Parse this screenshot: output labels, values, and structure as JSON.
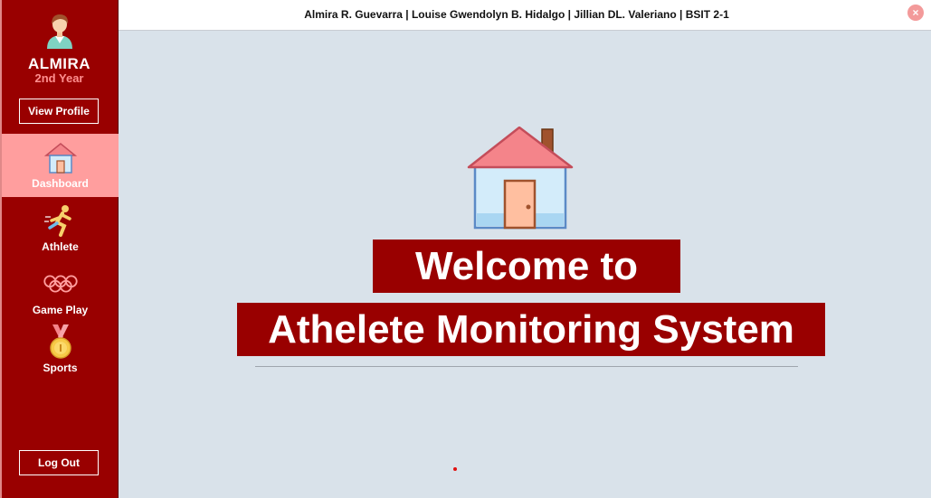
{
  "user": {
    "name": "ALMIRA",
    "year": "2nd Year"
  },
  "sidebar": {
    "view_profile_label": "View Profile",
    "logout_label": "Log Out",
    "items": [
      {
        "label": "Dashboard",
        "icon": "house-icon",
        "active": true
      },
      {
        "label": "Athlete",
        "icon": "runner-icon",
        "active": false
      },
      {
        "label": "Game Play",
        "icon": "olympic-rings-icon",
        "active": false
      },
      {
        "label": "Sports",
        "icon": "medal-icon",
        "active": false
      }
    ]
  },
  "header": {
    "title": "Almira R. Guevarra | Louise Gwendolyn B. Hidalgo | Jillian DL. Valeriano | BSIT 2-1",
    "close_label": "×"
  },
  "main": {
    "welcome_line1": "Welcome to",
    "welcome_line2": "Athelete Monitoring System"
  },
  "colors": {
    "sidebar": "#990000",
    "active_item": "#ff9e9e",
    "background": "#d9e2ea",
    "close_button": "#f39a9a"
  }
}
